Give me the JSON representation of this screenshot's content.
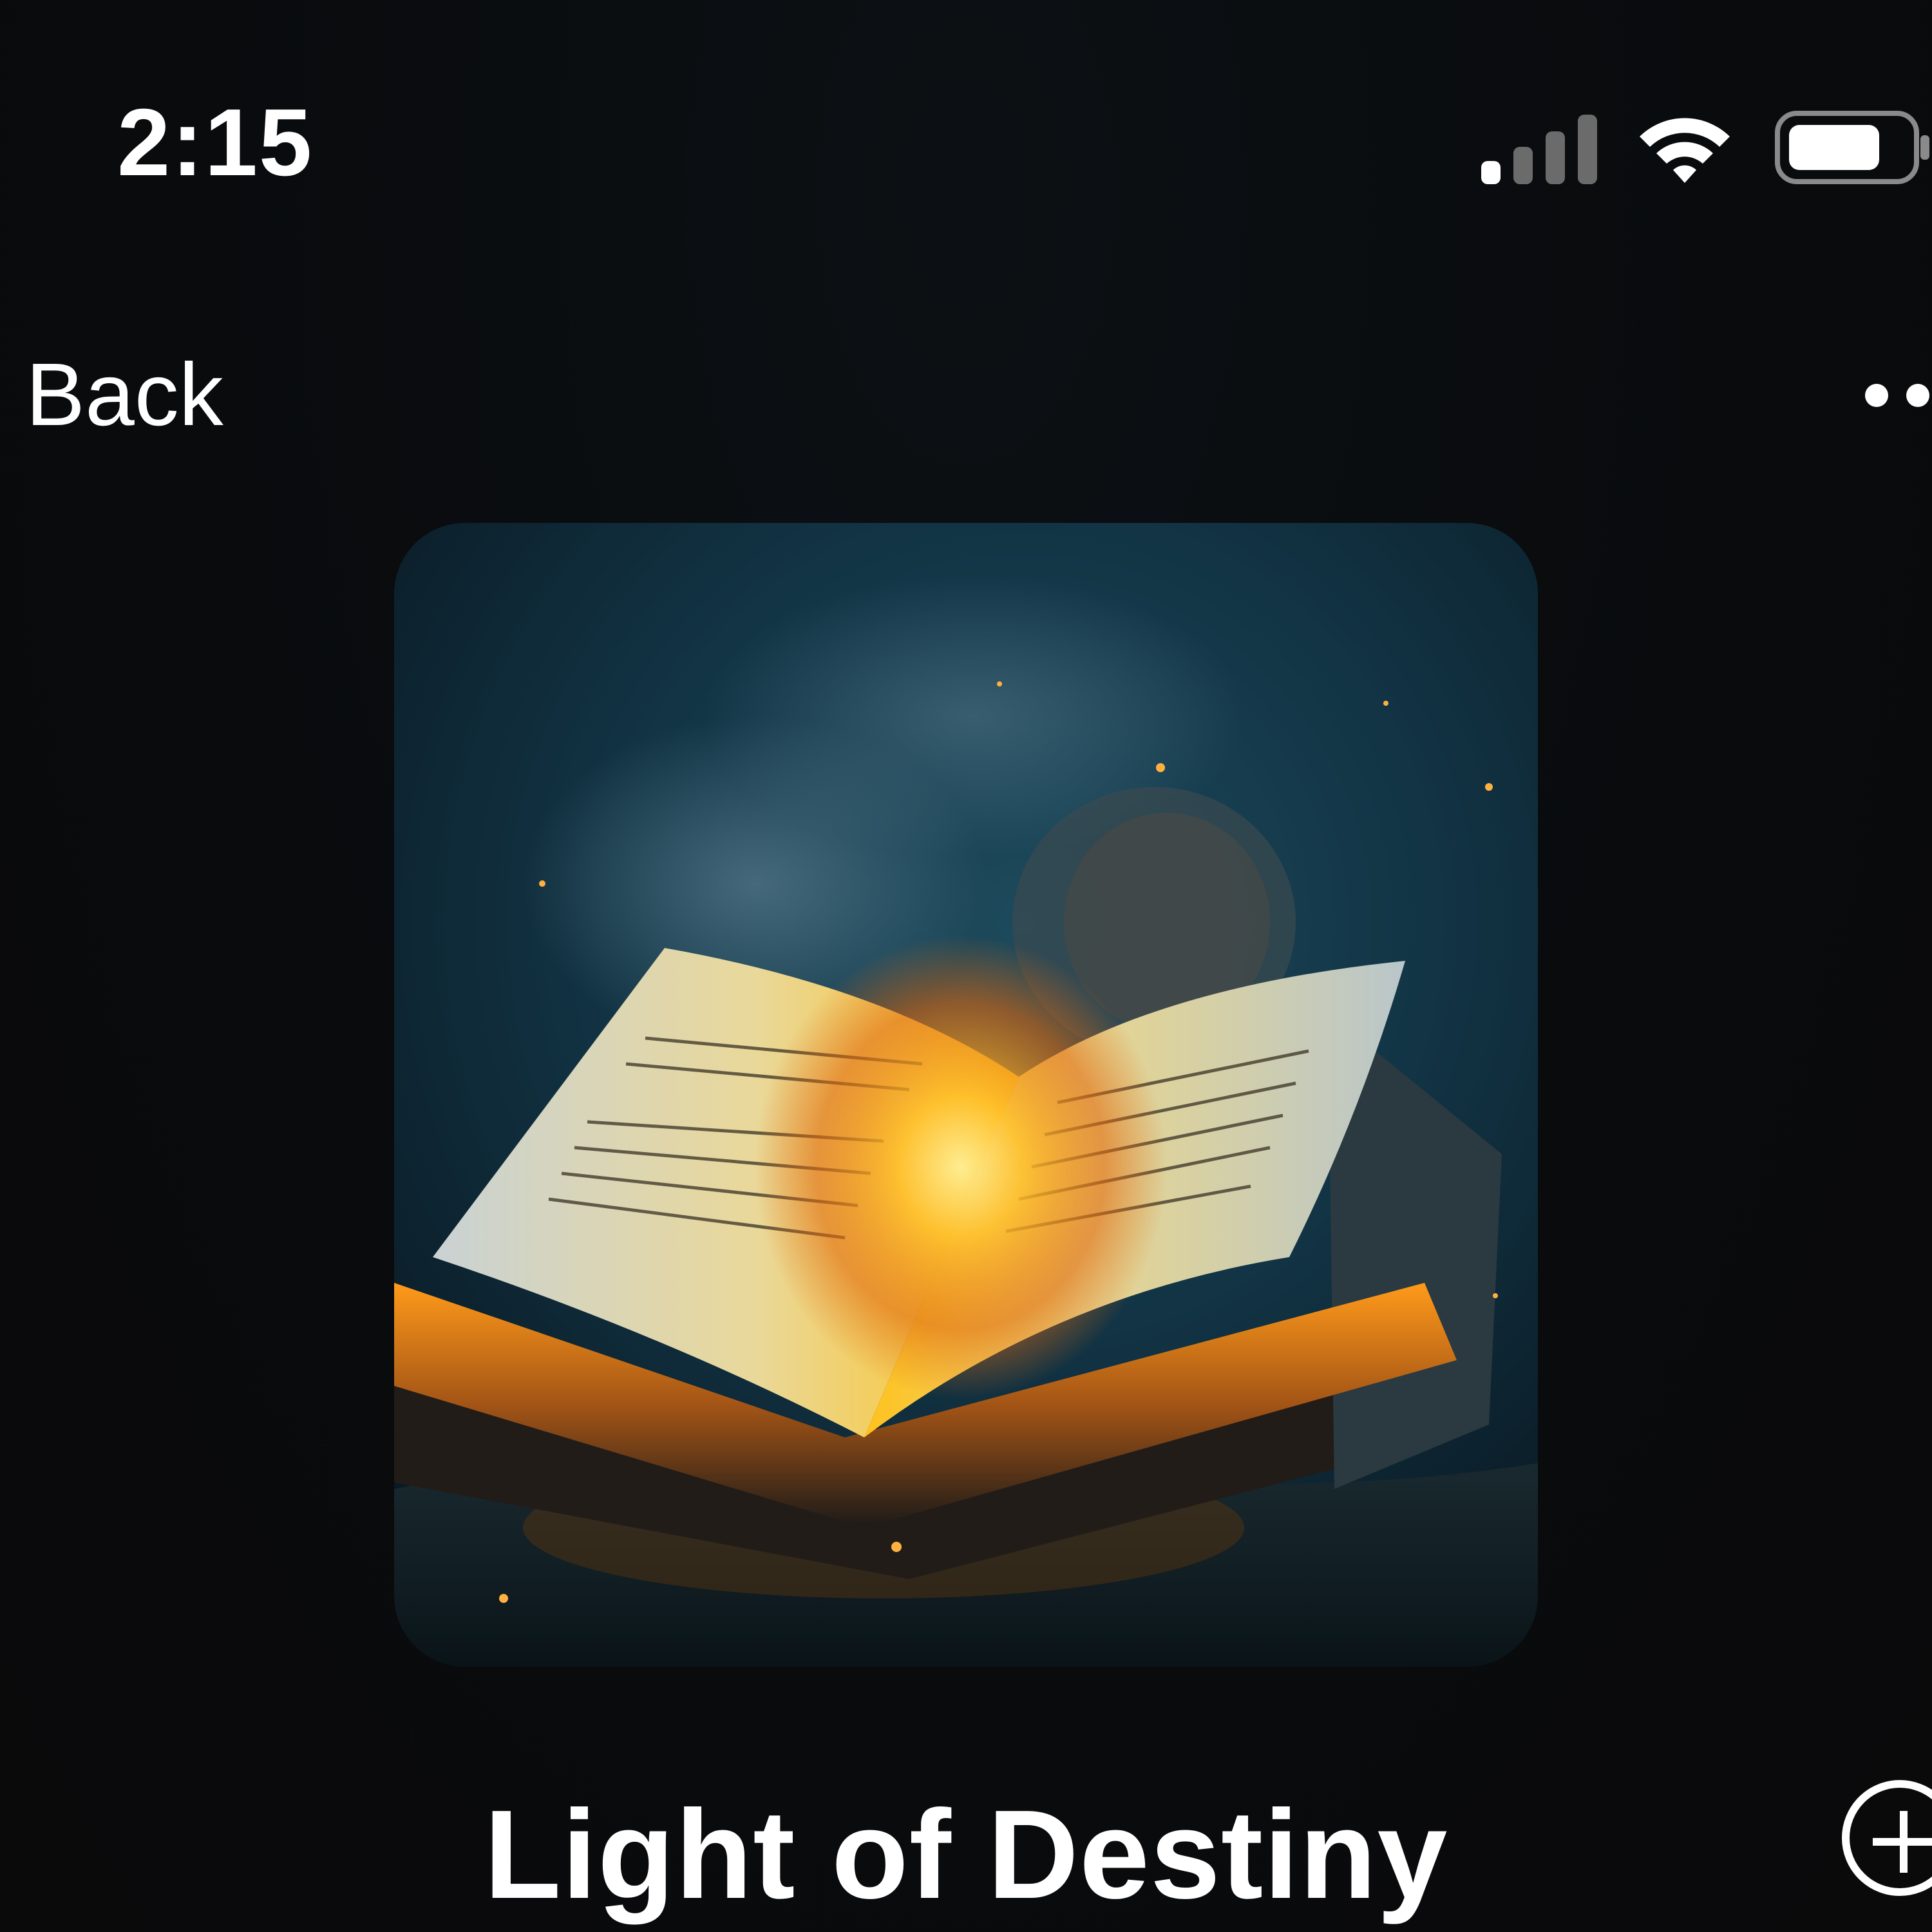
{
  "status_bar": {
    "time": "2:15",
    "icons": [
      "signal-icon",
      "wifi-icon",
      "battery-icon"
    ]
  },
  "nav": {
    "back_label": "Back",
    "more_icon": "more-icon"
  },
  "artwork": {
    "subject": "open-glowing-book-image"
  },
  "album": {
    "title": "Light of Destiny",
    "add_icon": "add-circle-icon"
  },
  "colors": {
    "background": "#0b0c0d",
    "text": "#ffffff",
    "glow": "#ffb020",
    "sky": "#14394a"
  }
}
